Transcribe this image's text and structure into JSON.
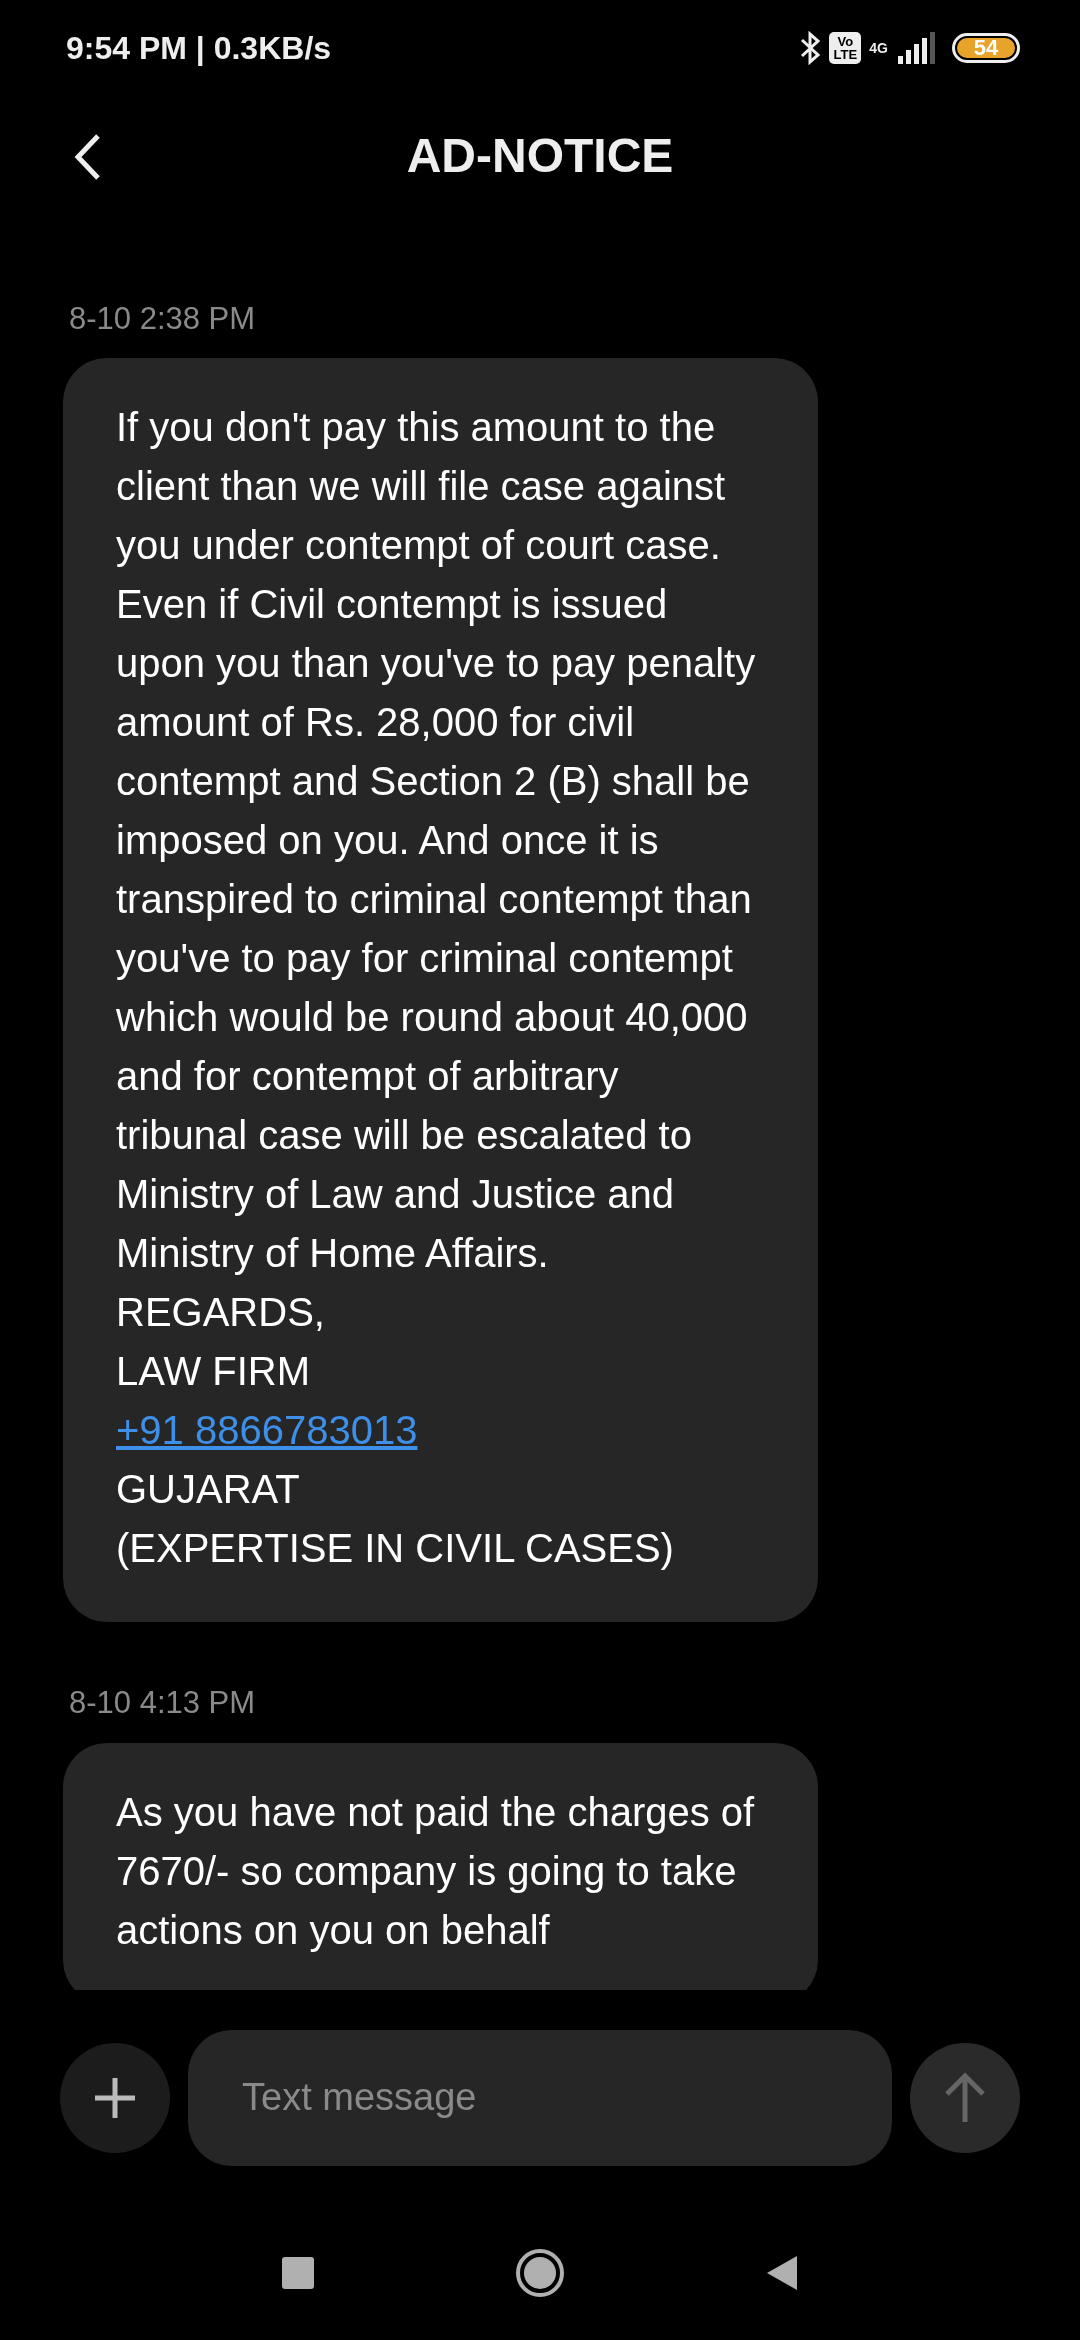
{
  "status_bar": {
    "time": "9:54 PM | 0.3KB/s",
    "volte": [
      "Vo",
      "LTE"
    ],
    "network": "4G",
    "battery": "54"
  },
  "header": {
    "title": "AD-NOTICE"
  },
  "messages": [
    {
      "timestamp": "8-10 2:38 PM",
      "parts": [
        {
          "kind": "text",
          "text": "If you don't pay this amount to the client than we will file case against you under contempt of court case. Even if Civil contempt is issued upon you than you've to pay penalty amount of Rs. 28,000 for civil contempt and Section 2 (B) shall be imposed on you. And once it is transpired to criminal contempt than you've to pay for criminal contempt which would be round about 40,000 and for contempt of arbitrary tribunal case will be escalated to Ministry of Law and Justice and Ministry of Home Affairs."
        },
        {
          "kind": "text",
          "text": "REGARDS,"
        },
        {
          "kind": "text",
          "text": "LAW FIRM"
        },
        {
          "kind": "link",
          "text": "+91 8866783013"
        },
        {
          "kind": "text",
          "text": "GUJARAT"
        },
        {
          "kind": "text",
          "text": "(EXPERTISE IN CIVIL CASES)"
        }
      ]
    },
    {
      "timestamp": "8-10 4:13 PM",
      "parts": [
        {
          "kind": "text",
          "text": "As you have not paid the charges of 7670/- so company is going to take actions on you on behalf"
        }
      ]
    }
  ],
  "composer": {
    "placeholder": "Text message"
  }
}
